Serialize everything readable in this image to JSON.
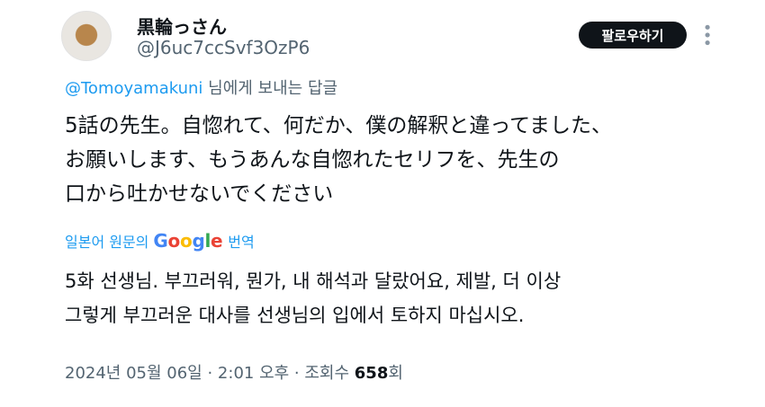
{
  "author": {
    "name": "黒輪っさん",
    "handle": "@J6uc7ccSvf3OzP6"
  },
  "follow_label": "팔로우하기",
  "more_icon": "more-dots-icon",
  "reply": {
    "mention": "@Tomoyamakuni",
    "suffix": " 님에게 보내는 답글"
  },
  "tweet": {
    "lines": [
      "5話の先生。自惚れて、何だか、僕の解釈と違ってました、",
      "お願いします、もうあんな自惚れたセリフを、先生の",
      "口から吐かせないでください"
    ]
  },
  "translation": {
    "prefix": "일본어 원문의",
    "brand": "Google",
    "suffix": "번역",
    "lines": [
      "5화 선생님. 부끄러워, 뭔가, 내 해석과 달랐어요, 제발, 더 이상",
      "그렇게 부끄러운 대사를 선생님의 입에서 토하지 마십시오."
    ]
  },
  "meta": {
    "date": "2024년 05월 06일",
    "sep1": " · ",
    "time": "2:01 오후",
    "sep2": " · ",
    "views_label": "조회수 ",
    "views_count": "658",
    "views_suffix": "회"
  },
  "colors": {
    "link": "#1d9bf0",
    "secondary": "#536471",
    "primary": "#0f1419",
    "button_bg": "#0f1419"
  }
}
